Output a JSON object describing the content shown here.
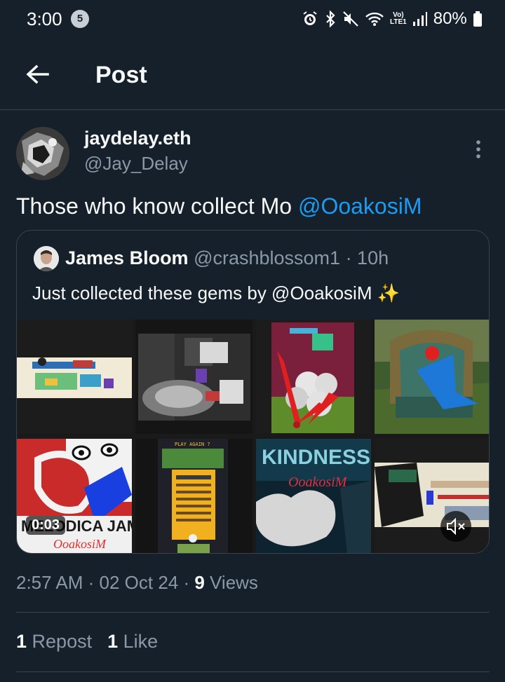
{
  "status_bar": {
    "time": "3:00",
    "notification_count": "5",
    "network": "LTE1",
    "volte": "Vo)",
    "battery": "80%"
  },
  "header": {
    "title": "Post",
    "back_icon": "arrow-left-icon"
  },
  "post": {
    "author_name": "jaydelay.eth",
    "author_handle": "@Jay_Delay",
    "text_before": "Those who know collect Mo ",
    "mention": "@OoakosiM",
    "more_icon": "vertical-ellipsis-icon"
  },
  "quote": {
    "name": "James Bloom",
    "meta": " @crashblossom1 · 10h",
    "text": "Just collected these gems by @OoakosiM ✨",
    "media": {
      "duration": "0:03",
      "tile_texts": {
        "melodica": "MELODICA JAM",
        "kindness": "KINDNESS",
        "signature": "OoakosiM",
        "game": "PLAY AGAIN ?"
      }
    }
  },
  "meta": {
    "time": "2:57 AM",
    "sep1": " · ",
    "date": "02 Oct 24",
    "sep2": " · ",
    "views_count": "9",
    "views_label": " Views"
  },
  "stats": {
    "reposts_count": "1",
    "reposts_label": " Repost",
    "likes_count": "1",
    "likes_label": " Like"
  },
  "colors": {
    "background": "#15202b",
    "accent": "#1d9bf0",
    "secondary_text": "#8b98a5",
    "border": "#38444d"
  }
}
